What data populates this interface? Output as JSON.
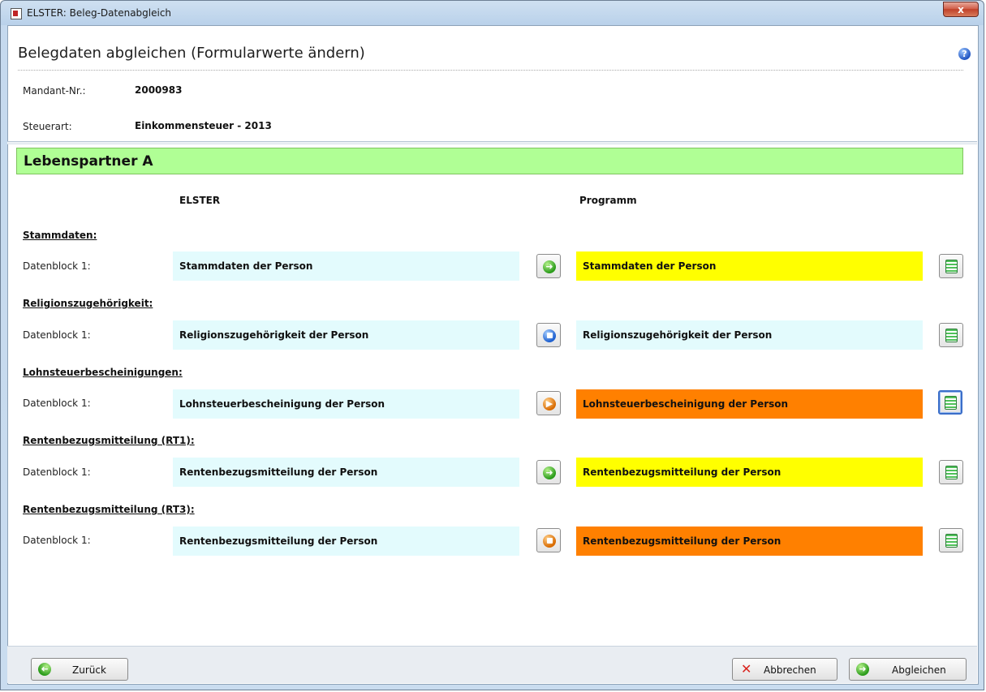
{
  "window": {
    "title": "ELSTER: Beleg-Datenabgleich",
    "close_label": "x"
  },
  "header": {
    "title": "Belegdaten abgleichen (Formularwerte ändern)",
    "help_icon": "help-icon",
    "help_glyph": "?"
  },
  "info": {
    "mandant_label": "Mandant-Nr.:",
    "mandant_value": "2000983",
    "steuerart_label": "Steuerart:",
    "steuerart_value": "Einkommensteuer - 2013"
  },
  "person": {
    "title": "Lebenspartner A"
  },
  "columns": {
    "left": "ELSTER",
    "right": "Programm"
  },
  "sections": [
    {
      "title": "Stammdaten:",
      "row_label": "Datenblock 1:",
      "elster_value": "Stammdaten der Person",
      "action_icon": "arrow-right-icon",
      "action_color": "green",
      "programm_value": "Stammdaten der Person",
      "programm_color": "#ffff00"
    },
    {
      "title": "Religionszugehörigkeit:",
      "row_label": "Datenblock 1:",
      "elster_value": "Religionszugehörigkeit der Person",
      "action_icon": "equal-icon",
      "action_color": "blue",
      "programm_value": "Religionszugehörigkeit der Person",
      "programm_color": "#e3fbfd"
    },
    {
      "title": "Lohnsteuerbescheinigungen:",
      "row_label": "Datenblock 1:",
      "elster_value": "Lohnsteuerbescheinigung der Person",
      "action_icon": "play-icon",
      "action_color": "orange",
      "programm_value": "Lohnsteuerbescheinigung der Person",
      "programm_color": "#ff8000"
    },
    {
      "title": "Rentenbezugsmitteilung (RT1):",
      "row_label": "Datenblock 1:",
      "elster_value": "Rentenbezugsmitteilung der Person",
      "action_icon": "arrow-right-icon",
      "action_color": "green",
      "programm_value": "Rentenbezugsmitteilung der Person",
      "programm_color": "#ffff00"
    },
    {
      "title": "Rentenbezugsmitteilung (RT3):",
      "row_label": "Datenblock 1:",
      "elster_value": "Rentenbezugsmitteilung der Person",
      "action_icon": "stop-icon",
      "action_color": "orange",
      "programm_value": "Rentenbezugsmitteilung der Person",
      "programm_color": "#ff8000"
    }
  ],
  "footer": {
    "back_label": "Zurück",
    "cancel_label": "Abbrechen",
    "apply_label": "Abgleichen"
  }
}
